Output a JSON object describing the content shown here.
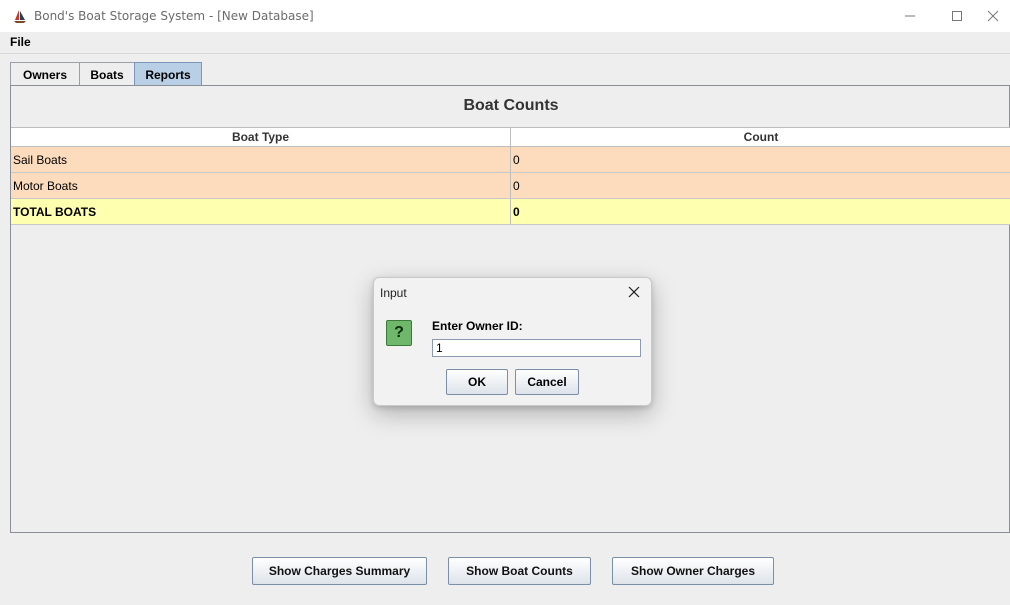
{
  "window": {
    "title": "Bond's Boat Storage System - [New Database]",
    "controls": [
      "minimize-icon",
      "maximize-icon",
      "close-icon"
    ]
  },
  "menu": {
    "file": "File"
  },
  "tabs": [
    {
      "label": "Owners",
      "selected": false
    },
    {
      "label": "Boats",
      "selected": false
    },
    {
      "label": "Reports",
      "selected": true
    }
  ],
  "report": {
    "title": "Boat Counts",
    "columns": [
      "Boat Type",
      "Count"
    ],
    "rows": [
      {
        "type": "Sail Boats",
        "count": "0"
      },
      {
        "type": "Motor Boats",
        "count": "0"
      },
      {
        "type": "TOTAL BOATS",
        "count": "0"
      }
    ]
  },
  "buttons": {
    "charges_summary": "Show Charges Summary",
    "boat_counts": "Show Boat Counts",
    "owner_charges": "Show Owner Charges"
  },
  "dialog": {
    "title": "Input",
    "icon": "question-icon",
    "prompt": "Enter Owner ID:",
    "input_value": "1",
    "ok": "OK",
    "cancel": "Cancel"
  },
  "colors": {
    "row_normal": "#fcdcbc",
    "row_total": "#ffffb0",
    "selected_tab": "#b8cfe5"
  }
}
